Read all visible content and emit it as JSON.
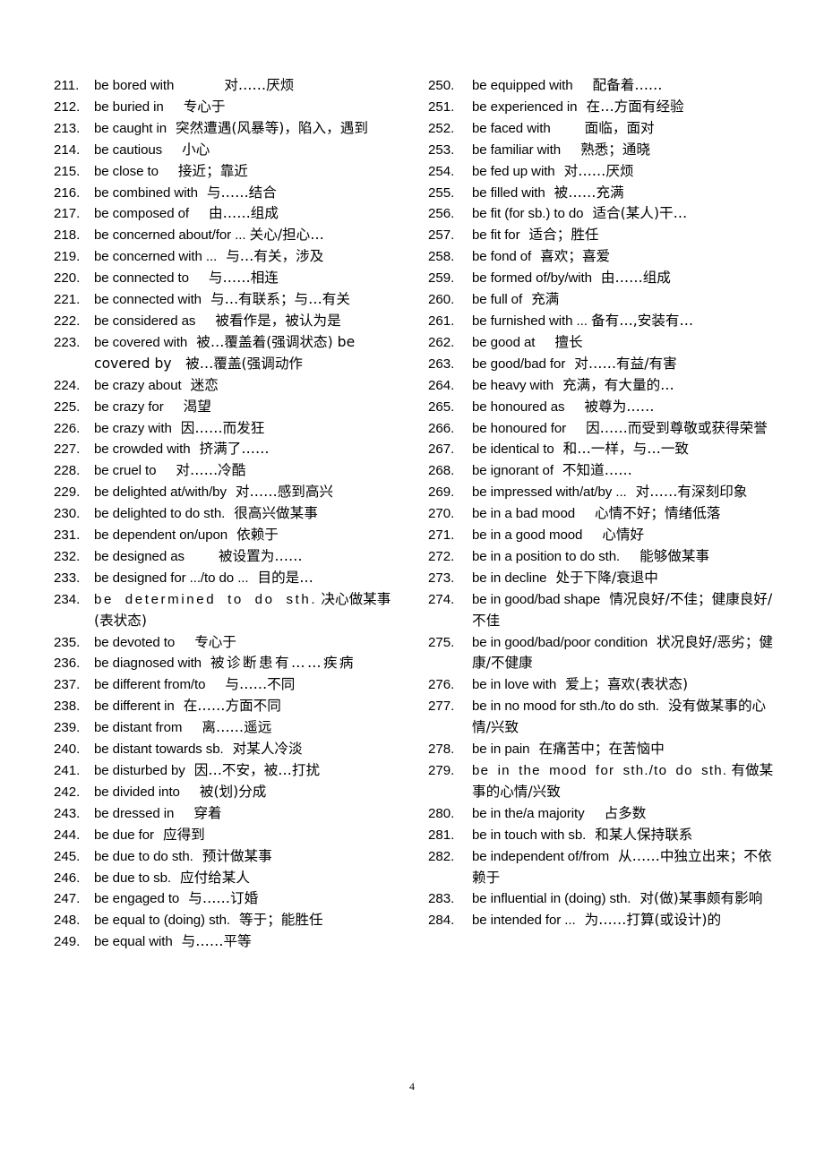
{
  "page": {
    "number": "4"
  },
  "left_column": [
    {
      "num": "211.",
      "en": "be bored with",
      "gap": "gap-xl",
      "zh": "对……厌烦"
    },
    {
      "num": "212.",
      "en": "be buried in",
      "gap": "gap-m",
      "zh": "专心于"
    },
    {
      "num": "213.",
      "en": "be caught in",
      "gap": "gap-s",
      "zh": "突然遭遇(风暴等)，陷入，遇到"
    },
    {
      "num": "214.",
      "en": "be cautious",
      "gap": "gap-m",
      "zh": "小心"
    },
    {
      "num": "215.",
      "en": "be close to",
      "gap": "gap-m",
      "zh": "接近；靠近"
    },
    {
      "num": "216.",
      "en": "be combined with",
      "gap": "gap-s",
      "zh": "与……结合"
    },
    {
      "num": "217.",
      "en": "be composed of",
      "gap": "gap-m",
      "zh": "由……组成"
    },
    {
      "num": "218.",
      "en": "be concerned about/for ...",
      "gap": "",
      "zh": "关心/担心…"
    },
    {
      "num": "219.",
      "en": "be concerned with ...",
      "gap": "gap-s",
      "zh": "与…有关，涉及"
    },
    {
      "num": "220.",
      "en": "be connected to",
      "gap": "gap-m",
      "zh": "与……相连"
    },
    {
      "num": "221.",
      "en": "be connected with",
      "gap": "gap-s",
      "zh": "与…有联系；与…有关"
    },
    {
      "num": "222.",
      "en": "be considered as",
      "gap": "gap-m",
      "zh": "被看作是，被认为是"
    },
    {
      "num": "223.",
      "en": "be covered with",
      "gap": "gap-s",
      "zh": "被…覆盖着(强调状态) be covered by　被…覆盖(强调动作",
      "mixed": true
    },
    {
      "num": "224.",
      "en": "be crazy about",
      "gap": "gap-s",
      "zh": "迷恋"
    },
    {
      "num": "225.",
      "en": "be crazy for",
      "gap": "gap-m",
      "zh": "渴望"
    },
    {
      "num": "226.",
      "en": "be crazy with",
      "gap": "gap-s",
      "zh": "因……而发狂"
    },
    {
      "num": "227.",
      "en": "be crowded with",
      "gap": "gap-s",
      "zh": "挤满了……"
    },
    {
      "num": "228.",
      "en": "be cruel to",
      "gap": "gap-m",
      "zh": "对……冷酷"
    },
    {
      "num": "229.",
      "en": "be delighted at/with/by",
      "gap": "gap-s",
      "zh": "对……感到高兴"
    },
    {
      "num": "230.",
      "en": "be delighted to do sth.",
      "gap": "gap-s",
      "zh": "很高兴做某事"
    },
    {
      "num": "231.",
      "en": "be dependent on/upon",
      "gap": "gap-s",
      "zh": "依赖于"
    },
    {
      "num": "232.",
      "en": "be designed as",
      "gap": "gap-l",
      "zh": "被设置为……"
    },
    {
      "num": "233.",
      "en": "be designed for .../to do ...",
      "gap": "gap-s",
      "zh": "目的是…"
    },
    {
      "num": "234.",
      "en": "be determined to do sth.",
      "gap": "",
      "zh": "决心做某事(表状态)",
      "spread": true
    },
    {
      "num": "235.",
      "en": "be devoted to",
      "gap": "gap-m",
      "zh": "专心于"
    },
    {
      "num": "236.",
      "en": "be diagnosed with",
      "gap": "gap-s",
      "zh": "被诊断患有……疾病",
      "spreadzh": true
    },
    {
      "num": "237.",
      "en": "be different from/to",
      "gap": "gap-m",
      "zh": "与……不同"
    },
    {
      "num": "238.",
      "en": "be different in",
      "gap": "gap-s",
      "zh": "在……方面不同"
    },
    {
      "num": "239.",
      "en": "be distant from",
      "gap": "gap-m",
      "zh": "离……遥远"
    },
    {
      "num": "240.",
      "en": "be distant towards sb.",
      "gap": "gap-s",
      "zh": "对某人冷淡"
    },
    {
      "num": "241.",
      "en": "be disturbed by",
      "gap": "gap-s",
      "zh": "因…不安，被…打扰"
    },
    {
      "num": "242.",
      "en": "be divided into",
      "gap": "gap-m",
      "zh": "被(划)分成"
    },
    {
      "num": "243.",
      "en": "be dressed in",
      "gap": "gap-m",
      "zh": "穿着"
    },
    {
      "num": "244.",
      "en": "be due for",
      "gap": "gap-s",
      "zh": "应得到"
    },
    {
      "num": "245.",
      "en": "be due to do sth.",
      "gap": "gap-s",
      "zh": "预计做某事"
    },
    {
      "num": "246.",
      "en": "be due to sb.",
      "gap": "gap-s",
      "zh": "应付给某人"
    },
    {
      "num": "247.",
      "en": "be engaged to",
      "gap": "gap-s",
      "zh": "与……订婚"
    },
    {
      "num": "248.",
      "en": "be equal to (doing) sth.",
      "gap": "gap-s",
      "zh": "等于；能胜任"
    },
    {
      "num": "249.",
      "en": "be equal with",
      "gap": "gap-s",
      "zh": "与……平等"
    }
  ],
  "right_column": [
    {
      "num": "250.",
      "en": "be equipped with",
      "gap": "gap-m",
      "zh": "配备着……"
    },
    {
      "num": "251.",
      "en": "be experienced in",
      "gap": "gap-s",
      "zh": "在…方面有经验"
    },
    {
      "num": "252.",
      "en": "be faced with",
      "gap": "gap-l",
      "zh": "面临，面对"
    },
    {
      "num": "253.",
      "en": "be familiar with",
      "gap": "gap-m",
      "zh": "熟悉；通晓"
    },
    {
      "num": "254.",
      "en": "be fed up with",
      "gap": "gap-s",
      "zh": "对……厌烦"
    },
    {
      "num": "255.",
      "en": "be filled with",
      "gap": "gap-s",
      "zh": "被……充满"
    },
    {
      "num": "256.",
      "en": "be fit (for sb.) to do",
      "gap": "gap-s",
      "zh": "适合(某人)干…"
    },
    {
      "num": "257.",
      "en": "be fit for",
      "gap": "gap-s",
      "zh": "适合；胜任"
    },
    {
      "num": "258.",
      "en": "be fond of",
      "gap": "gap-s",
      "zh": "喜欢；喜爱"
    },
    {
      "num": "259.",
      "en": "be formed of/by/with",
      "gap": "gap-s",
      "zh": "由……组成"
    },
    {
      "num": "260.",
      "en": "be full of",
      "gap": "gap-s",
      "zh": "充满"
    },
    {
      "num": "261.",
      "en": "be furnished with ...",
      "gap": "",
      "zh": "备有…,安装有…"
    },
    {
      "num": "262.",
      "en": "be good at",
      "gap": "gap-m",
      "zh": "擅长"
    },
    {
      "num": "263.",
      "en": "be good/bad for",
      "gap": "gap-s",
      "zh": "对……有益/有害"
    },
    {
      "num": "264.",
      "en": "be heavy with",
      "gap": "gap-s",
      "zh": "充满，有大量的…"
    },
    {
      "num": "265.",
      "en": "be honoured as",
      "gap": "gap-m",
      "zh": "被尊为……"
    },
    {
      "num": "266.",
      "en": "be honoured for",
      "gap": "gap-m",
      "zh": "因……而受到尊敬或获得荣誉"
    },
    {
      "num": "267.",
      "en": "be identical to",
      "gap": "gap-s",
      "zh": "和…一样，与…一致"
    },
    {
      "num": "268.",
      "en": "be ignorant of",
      "gap": "gap-s",
      "zh": "不知道……"
    },
    {
      "num": "269.",
      "en": "be impressed with/at/by ...",
      "gap": "gap-s",
      "zh": "对……有深刻印象"
    },
    {
      "num": "270.",
      "en": "be in a bad mood",
      "gap": "gap-m",
      "zh": "心情不好；情绪低落"
    },
    {
      "num": "271.",
      "en": "be in a good mood",
      "gap": "gap-m",
      "zh": "心情好"
    },
    {
      "num": "272.",
      "en": "be in a position to do sth.",
      "gap": "gap-m",
      "zh": "能够做某事"
    },
    {
      "num": "273.",
      "en": "be in decline",
      "gap": "gap-s",
      "zh": "处于下降/衰退中"
    },
    {
      "num": "274.",
      "en": "be in good/bad shape",
      "gap": "gap-s",
      "zh": "情况良好/不佳；健康良好/不佳"
    },
    {
      "num": "275.",
      "en": "be in good/bad/poor condition",
      "gap": "gap-s",
      "zh": "状况良好/恶劣；健康/不健康"
    },
    {
      "num": "276.",
      "en": "be in love with",
      "gap": "gap-s",
      "zh": "爱上；喜欢(表状态)"
    },
    {
      "num": "277.",
      "en": "be in no mood for sth./to do sth.",
      "gap": "gap-s",
      "zh": "没有做某事的心情/兴致"
    },
    {
      "num": "278.",
      "en": "be in pain",
      "gap": "gap-s",
      "zh": "在痛苦中；在苦恼中"
    },
    {
      "num": "279.",
      "en": "be in the mood for sth./to do sth.",
      "gap": "",
      "zh": "有做某事的心情/兴致",
      "spread2": true
    },
    {
      "num": "280.",
      "en": "be in the/a majority",
      "gap": "gap-m",
      "zh": "占多数"
    },
    {
      "num": "281.",
      "en": "be in touch with sb.",
      "gap": "gap-s",
      "zh": "和某人保持联系"
    },
    {
      "num": "282.",
      "en": "be independent of/from",
      "gap": "gap-s",
      "zh": "从……中独立出来；不依赖于"
    },
    {
      "num": "283.",
      "en": "be influential in (doing) sth.",
      "gap": "gap-s",
      "zh": "对(做)某事颇有影响"
    },
    {
      "num": "284.",
      "en": "be intended for ...",
      "gap": "gap-s",
      "zh": "为……打算(或设计)的"
    }
  ]
}
